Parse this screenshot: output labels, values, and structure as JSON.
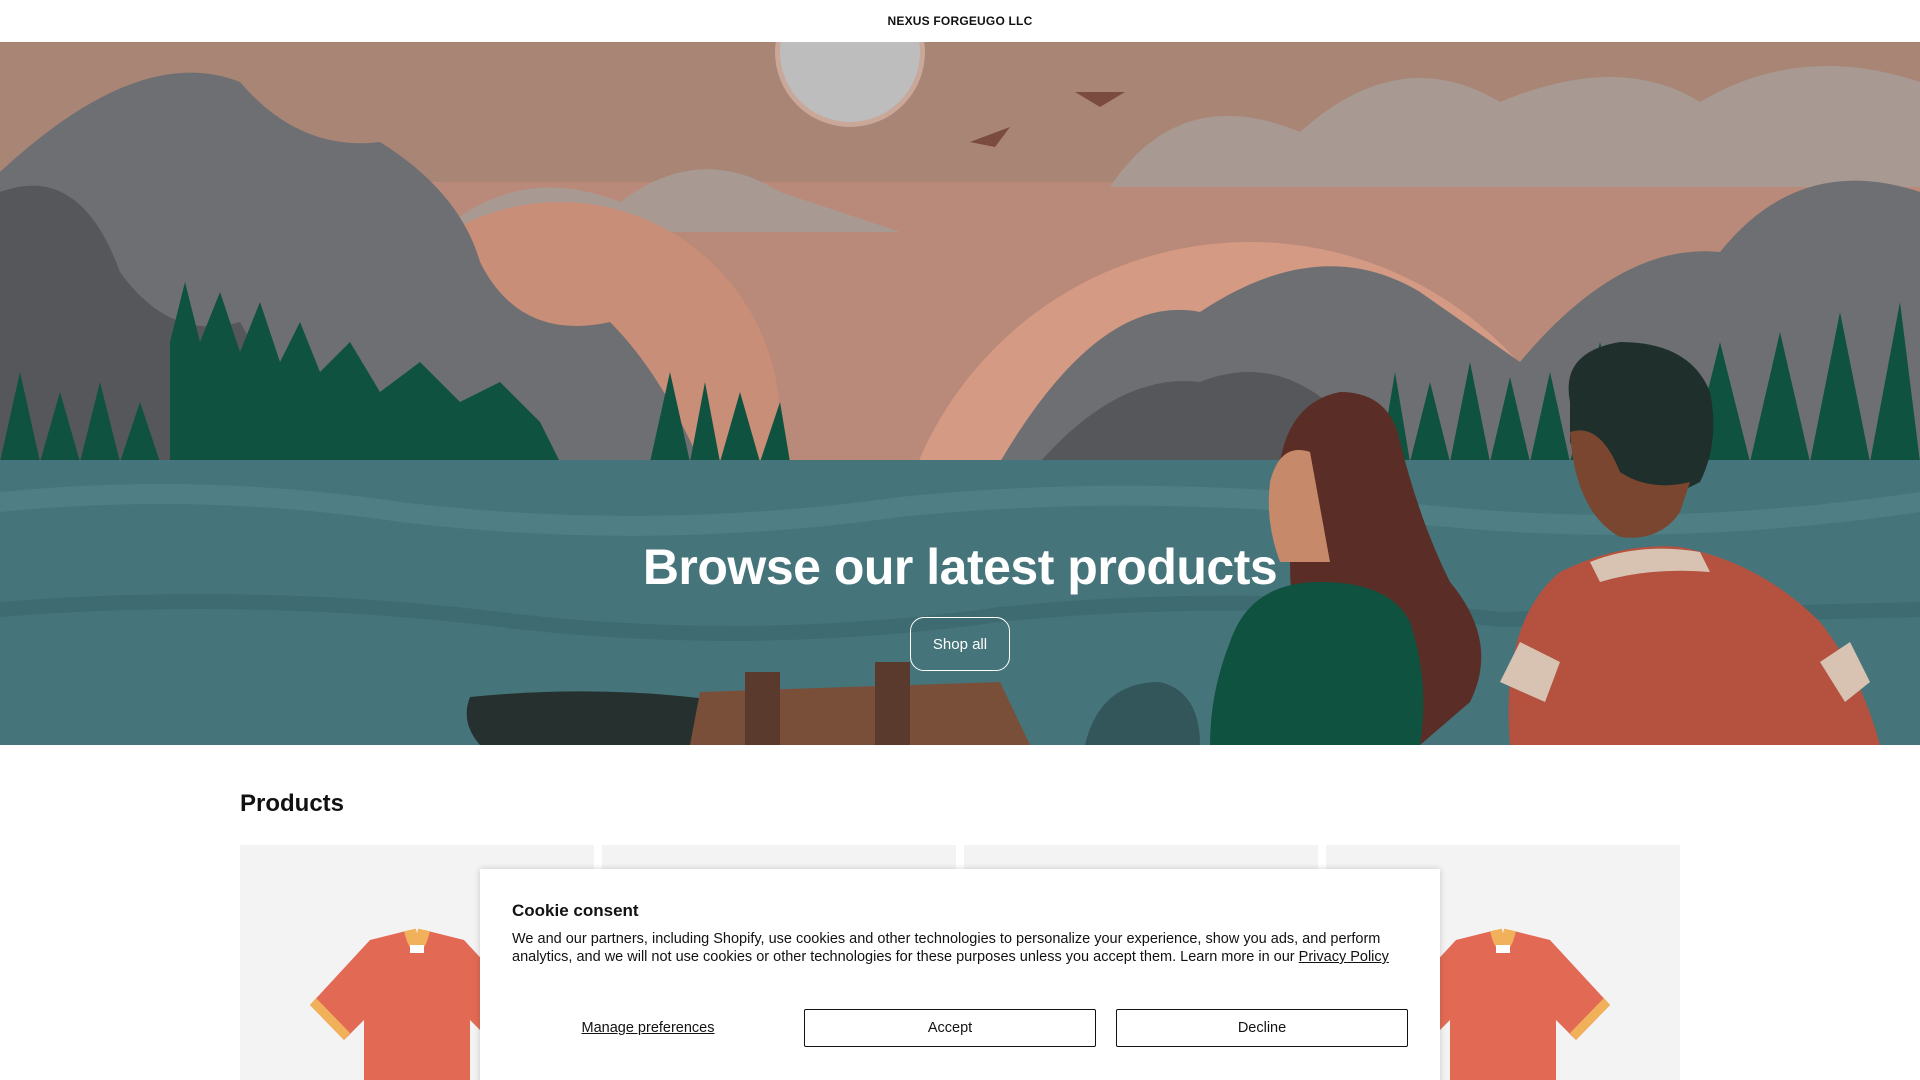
{
  "header": {
    "store_name": "NEXUS FORGEUGO LLC"
  },
  "hero": {
    "title": "Browse our latest products",
    "cta_label": "Shop all",
    "colors": {
      "sky": "#b98a79",
      "water": "#45747a",
      "trees": "#0f5240",
      "mountains": "#6e6f73"
    }
  },
  "products": {
    "title": "Products",
    "cards": [
      {
        "image": "red-tshirt-icon"
      },
      {
        "image": "product-placeholder"
      },
      {
        "image": "product-placeholder"
      },
      {
        "image": "red-tshirt-icon"
      }
    ]
  },
  "cookie": {
    "title": "Cookie consent",
    "body": "We and our partners, including Shopify, use cookies and other technologies to personalize your experience, show you ads, and perform analytics, and we will not use cookies or other technologies for these purposes unless you accept them. Learn more in our ",
    "privacy_link": "Privacy Policy",
    "manage_label": "Manage preferences",
    "accept_label": "Accept",
    "decline_label": "Decline"
  }
}
